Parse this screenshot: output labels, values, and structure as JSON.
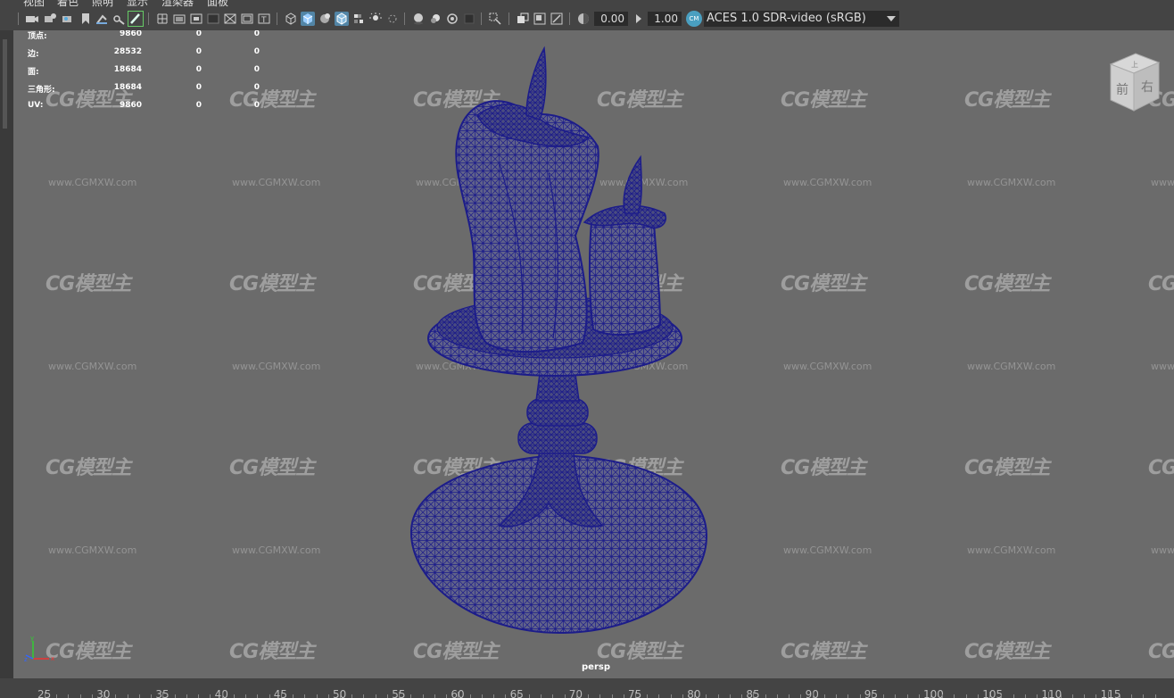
{
  "menu": [
    "视图",
    "着色",
    "照明",
    "显示",
    "渲染器",
    "面板"
  ],
  "toolbar": {
    "exposure": "0.00",
    "gamma": "1.00",
    "color_space": "ACES 1.0 SDR-video (sRGB)"
  },
  "stats": [
    {
      "label": "顶点:",
      "v1": "9860",
      "v2": "0",
      "v3": "0"
    },
    {
      "label": "边:",
      "v1": "28532",
      "v2": "0",
      "v3": "0"
    },
    {
      "label": "面:",
      "v1": "18684",
      "v2": "0",
      "v3": "0"
    },
    {
      "label": "三角形:",
      "v1": "18684",
      "v2": "0",
      "v3": "0"
    },
    {
      "label": "UV:",
      "v1": "9860",
      "v2": "0",
      "v3": "0"
    }
  ],
  "camera_label": "persp",
  "view_cube": {
    "front": "前",
    "right": "右",
    "top": "上"
  },
  "watermark": {
    "logo": "CG模型主",
    "url": "www.CGMXW.com"
  },
  "timeline": [
    "25",
    "30",
    "35",
    "40",
    "45",
    "50",
    "55",
    "60",
    "65",
    "70",
    "75",
    "80",
    "85",
    "90",
    "95",
    "100",
    "105",
    "110",
    "115"
  ],
  "colors": {
    "wireframe": "#1c1c8a",
    "viewport_bg": "#6b6b6b",
    "active_icon": "#5285a6"
  }
}
